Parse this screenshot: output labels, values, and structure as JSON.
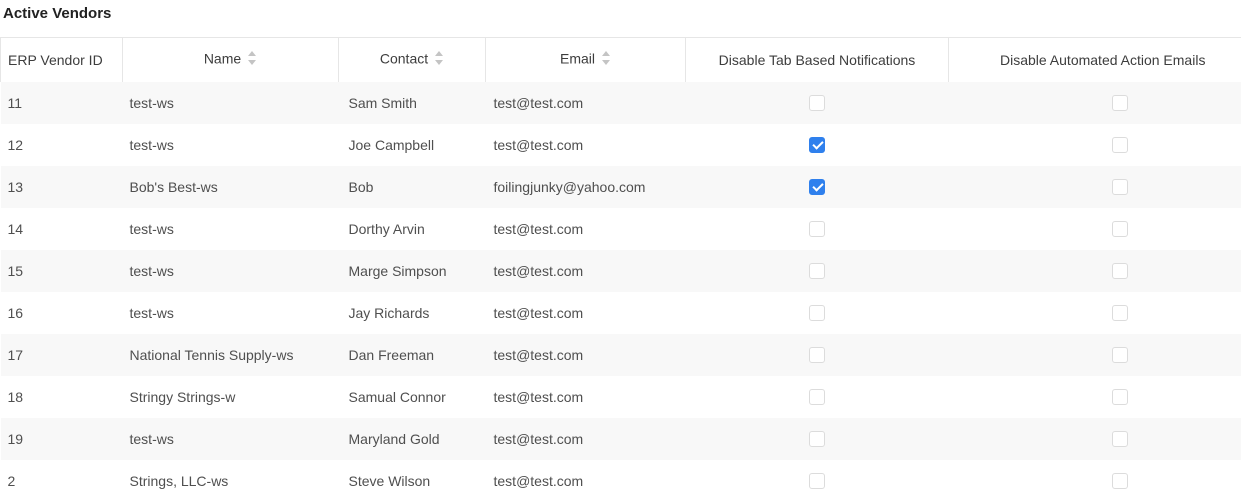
{
  "title": "Active Vendors",
  "columns": {
    "erp_vendor_id": "ERP Vendor ID",
    "name": "Name",
    "contact": "Contact",
    "email": "Email",
    "disable_tab_notifications": "Disable Tab Based Notifications",
    "disable_action_emails": "Disable Automated Action Emails"
  },
  "colors": {
    "checkbox_checked": "#2f80ed",
    "row_stripe": "#f8f8f8"
  },
  "rows": [
    {
      "id": "11",
      "name": "test-ws",
      "contact": "Sam Smith",
      "email": "test@test.com",
      "tab_notif": false,
      "action_emails": false
    },
    {
      "id": "12",
      "name": "test-ws",
      "contact": "Joe Campbell",
      "email": "test@test.com",
      "tab_notif": true,
      "action_emails": false
    },
    {
      "id": "13",
      "name": "Bob's Best-ws",
      "contact": "Bob",
      "email": "foilingjunky@yahoo.com",
      "tab_notif": true,
      "action_emails": false
    },
    {
      "id": "14",
      "name": "test-ws",
      "contact": "Dorthy Arvin",
      "email": "test@test.com",
      "tab_notif": false,
      "action_emails": false
    },
    {
      "id": "15",
      "name": "test-ws",
      "contact": "Marge Simpson",
      "email": "test@test.com",
      "tab_notif": false,
      "action_emails": false
    },
    {
      "id": "16",
      "name": "test-ws",
      "contact": "Jay Richards",
      "email": "test@test.com",
      "tab_notif": false,
      "action_emails": false
    },
    {
      "id": "17",
      "name": "National Tennis Supply-ws",
      "contact": "Dan Freeman",
      "email": "test@test.com",
      "tab_notif": false,
      "action_emails": false
    },
    {
      "id": "18",
      "name": "Stringy Strings-w",
      "contact": "Samual Connor",
      "email": "test@test.com",
      "tab_notif": false,
      "action_emails": false
    },
    {
      "id": "19",
      "name": "test-ws",
      "contact": "Maryland Gold",
      "email": "test@test.com",
      "tab_notif": false,
      "action_emails": false
    },
    {
      "id": "2",
      "name": "Strings, LLC-ws",
      "contact": "Steve Wilson",
      "email": "test@test.com",
      "tab_notif": false,
      "action_emails": false
    }
  ]
}
